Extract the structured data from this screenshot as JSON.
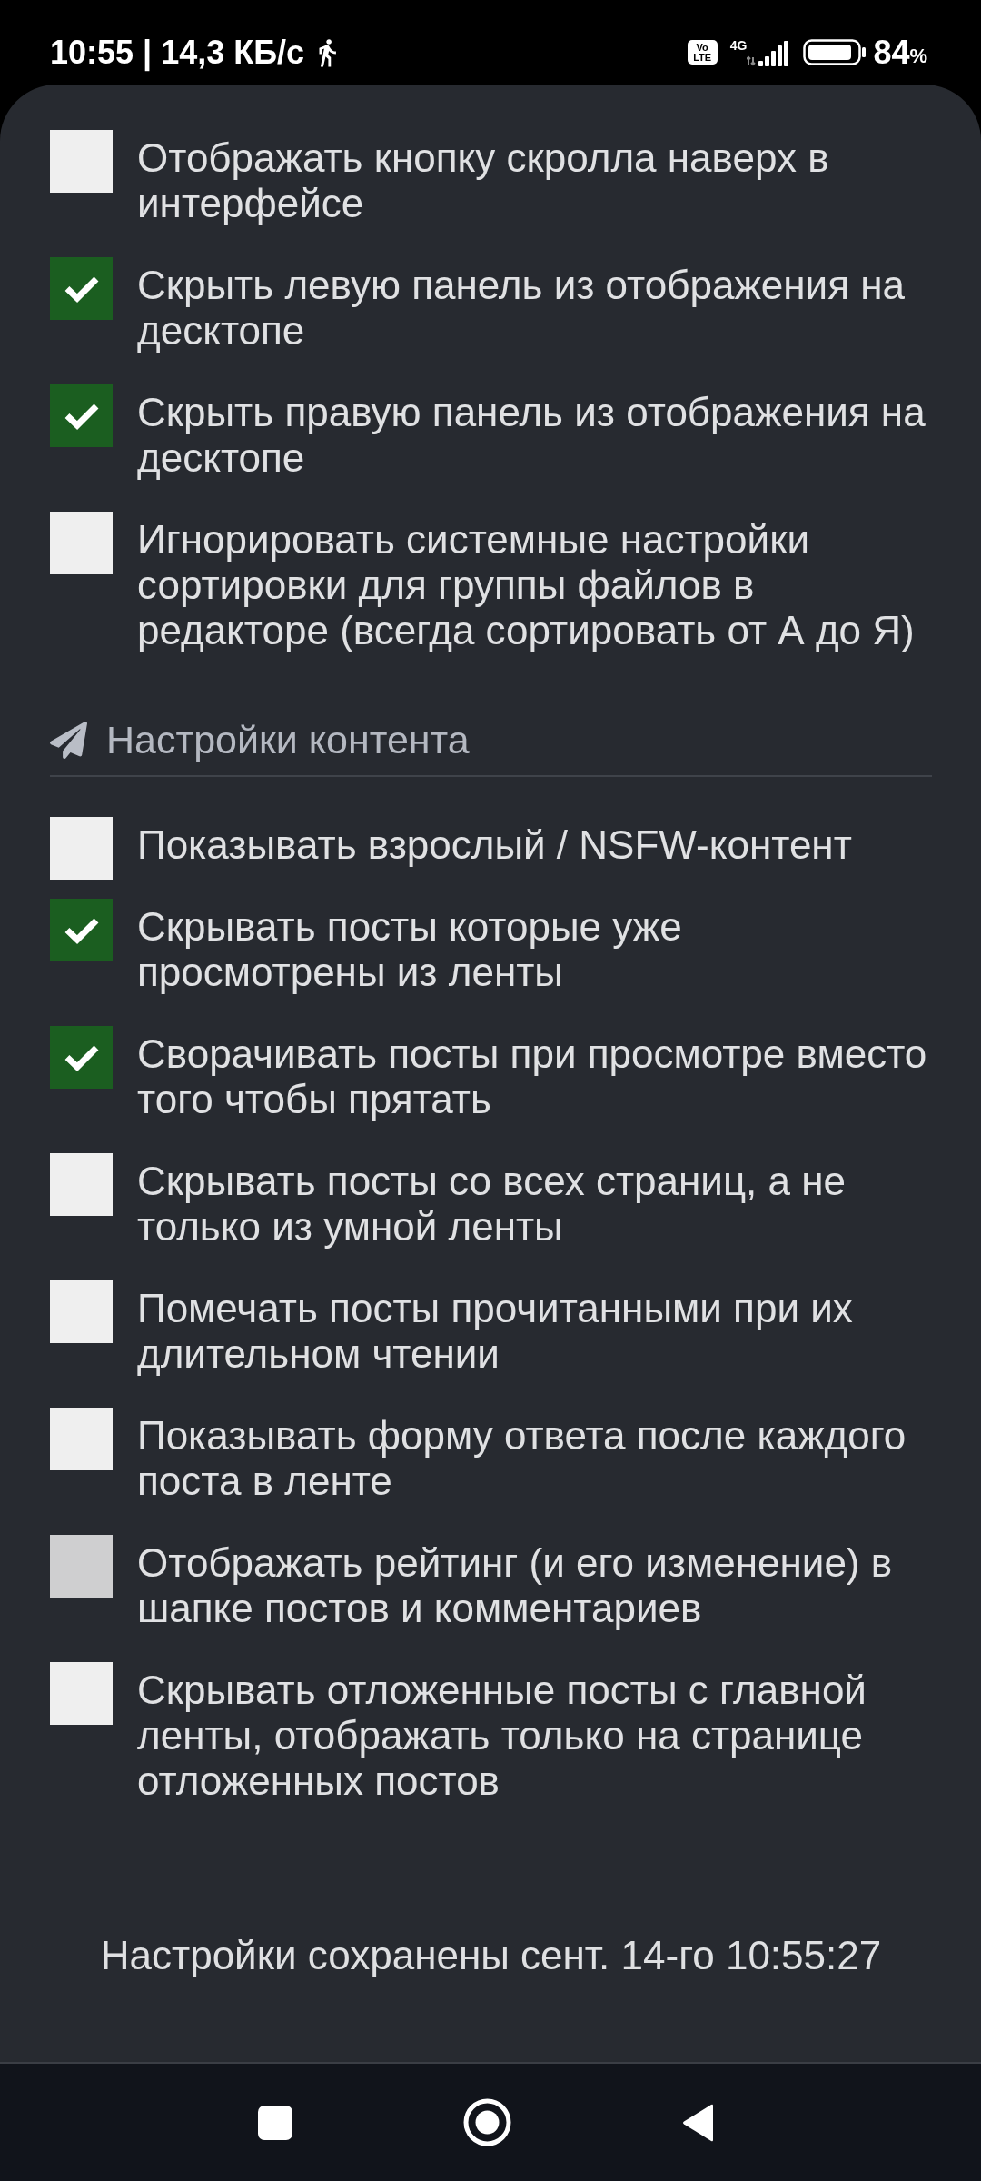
{
  "status_bar": {
    "time_and_speed": "10:55 | 14,3 КБ/с",
    "network_badge": [
      "Vo",
      "LTE"
    ],
    "network_type": "4G",
    "battery_percent": "84",
    "battery_unit": "%"
  },
  "sections": [
    {
      "items": [
        {
          "label": "Отображать кнопку скролла наверх в интерфейсе",
          "checked": false,
          "focused": false
        },
        {
          "label": "Скрыть левую панель из отображения на десктопе",
          "checked": true,
          "focused": false
        },
        {
          "label": "Скрыть правую панель из отображения на десктопе",
          "checked": true,
          "focused": false
        },
        {
          "label": "Игнорировать системные настройки сортировки для группы файлов в редакторе (всегда сортировать от А до Я)",
          "checked": false,
          "focused": false
        }
      ]
    },
    {
      "title": "Настройки контента",
      "items": [
        {
          "label": "Показывать взрослый / NSFW-контент",
          "checked": false,
          "focused": false
        },
        {
          "label": "Скрывать посты которые уже просмотрены из ленты",
          "checked": true,
          "focused": false
        },
        {
          "label": "Сворачивать посты при просмотре вместо того чтобы прятать",
          "checked": true,
          "focused": false
        },
        {
          "label": "Скрывать посты со всех страниц, а не только из умной ленты",
          "checked": false,
          "focused": false
        },
        {
          "label": "Помечать посты прочитанными при их длительном чтении",
          "checked": false,
          "focused": false
        },
        {
          "label": "Показывать форму ответа после каждого поста в ленте",
          "checked": false,
          "focused": false
        },
        {
          "label": "Отображать рейтинг (и его изменение) в шапке постов и комментариев",
          "checked": false,
          "focused": true
        },
        {
          "label": "Скрывать отложенные посты с главной ленты, отображать только на странице отложенных постов",
          "checked": false,
          "focused": false
        }
      ]
    }
  ],
  "saved_message": "Настройки сохранены сент. 14-го 10:55:27"
}
